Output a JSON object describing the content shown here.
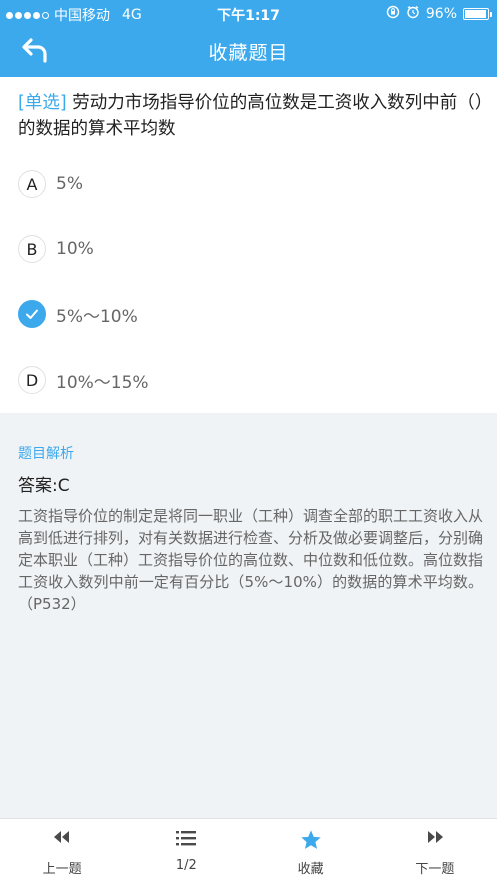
{
  "status_bar": {
    "carrier": "中国移动",
    "network": "4G",
    "time": "下午1:17",
    "battery": "96%",
    "battery_level": 0.96
  },
  "navbar": {
    "title": "收藏题目",
    "back_icon": "back-arrow-icon"
  },
  "question": {
    "type_label": "[单选]",
    "text": "劳动力市场指导价位的高位数是工资收入数列中前（）的数据的算术平均数",
    "options": [
      {
        "key": "A",
        "text": "5%",
        "selected": false
      },
      {
        "key": "B",
        "text": "10%",
        "selected": false
      },
      {
        "key": "C",
        "text": "5%～10%",
        "selected": true
      },
      {
        "key": "D",
        "text": "10%～15%",
        "selected": false
      }
    ]
  },
  "analysis": {
    "title": "题目解析",
    "answer": "答案:C",
    "explanation": "工资指导价位的制定是将同一职业（工种）调查全部的职工工资收入从高到低进行排列，对有关数据进行检查、分析及做必要调整后，分别确定本职业（工种）工资指导价位的高位数、中位数和低位数。高位数指工资收入数列中前一定有百分比（5%～10%）的数据的算术平均数。（P532）"
  },
  "tabbar": {
    "items": [
      {
        "label": "上一题",
        "icon": "previous-icon"
      },
      {
        "label": "1/2",
        "icon": "list-icon"
      },
      {
        "label": "收藏",
        "icon": "star-icon"
      },
      {
        "label": "下一题",
        "icon": "next-icon"
      }
    ]
  },
  "colors": {
    "accent": "#3ca9ec",
    "background": "#f0f3f6",
    "text": "#222222",
    "secondary_text": "#666666"
  }
}
